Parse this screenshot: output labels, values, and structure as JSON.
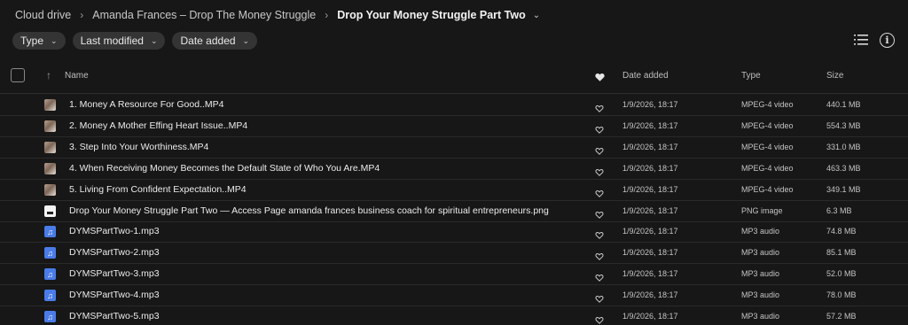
{
  "breadcrumb": {
    "root": "Cloud drive",
    "parent": "Amanda Frances – Drop The Money Struggle",
    "current": "Drop Your Money Struggle Part Two"
  },
  "filters": {
    "type": "Type",
    "last_modified": "Last modified",
    "date_added": "Date added"
  },
  "header": {
    "name": "Name",
    "date_added": "Date added",
    "type": "Type",
    "size": "Size"
  },
  "icons": {
    "sort": "arrow-up-icon",
    "favorite": "heart-icon",
    "list_view": "list-view-icon",
    "info": "info-icon"
  },
  "files": [
    {
      "name": "1. Money A Resource For Good..MP4",
      "date": "1/9/2026, 18:17",
      "type": "MPEG-4 video",
      "size": "440.1 MB",
      "kind": "video"
    },
    {
      "name": "2. Money A Mother Effing Heart Issue..MP4",
      "date": "1/9/2026, 18:17",
      "type": "MPEG-4 video",
      "size": "554.3 MB",
      "kind": "video"
    },
    {
      "name": "3. Step Into Your Worthiness.MP4",
      "date": "1/9/2026, 18:17",
      "type": "MPEG-4 video",
      "size": "331.0 MB",
      "kind": "video"
    },
    {
      "name": "4. When Receiving Money Becomes the Default State of Who You Are.MP4",
      "date": "1/9/2026, 18:17",
      "type": "MPEG-4 video",
      "size": "463.3 MB",
      "kind": "video"
    },
    {
      "name": "5. Living From Confident Expectation..MP4",
      "date": "1/9/2026, 18:17",
      "type": "MPEG-4 video",
      "size": "349.1 MB",
      "kind": "video"
    },
    {
      "name": "Drop Your Money Struggle Part Two — Access Page amanda frances business coach for spiritual entrepreneurs.png",
      "date": "1/9/2026, 18:17",
      "type": "PNG image",
      "size": "6.3 MB",
      "kind": "image"
    },
    {
      "name": "DYMSPartTwo-1.mp3",
      "date": "1/9/2026, 18:17",
      "type": "MP3 audio",
      "size": "74.8 MB",
      "kind": "audio"
    },
    {
      "name": "DYMSPartTwo-2.mp3",
      "date": "1/9/2026, 18:17",
      "type": "MP3 audio",
      "size": "85.1 MB",
      "kind": "audio"
    },
    {
      "name": "DYMSPartTwo-3.mp3",
      "date": "1/9/2026, 18:17",
      "type": "MP3 audio",
      "size": "52.0 MB",
      "kind": "audio"
    },
    {
      "name": "DYMSPartTwo-4.mp3",
      "date": "1/9/2026, 18:17",
      "type": "MP3 audio",
      "size": "78.0 MB",
      "kind": "audio"
    },
    {
      "name": "DYMSPartTwo-5.mp3",
      "date": "1/9/2026, 18:17",
      "type": "MP3 audio",
      "size": "57.2 MB",
      "kind": "audio"
    }
  ]
}
